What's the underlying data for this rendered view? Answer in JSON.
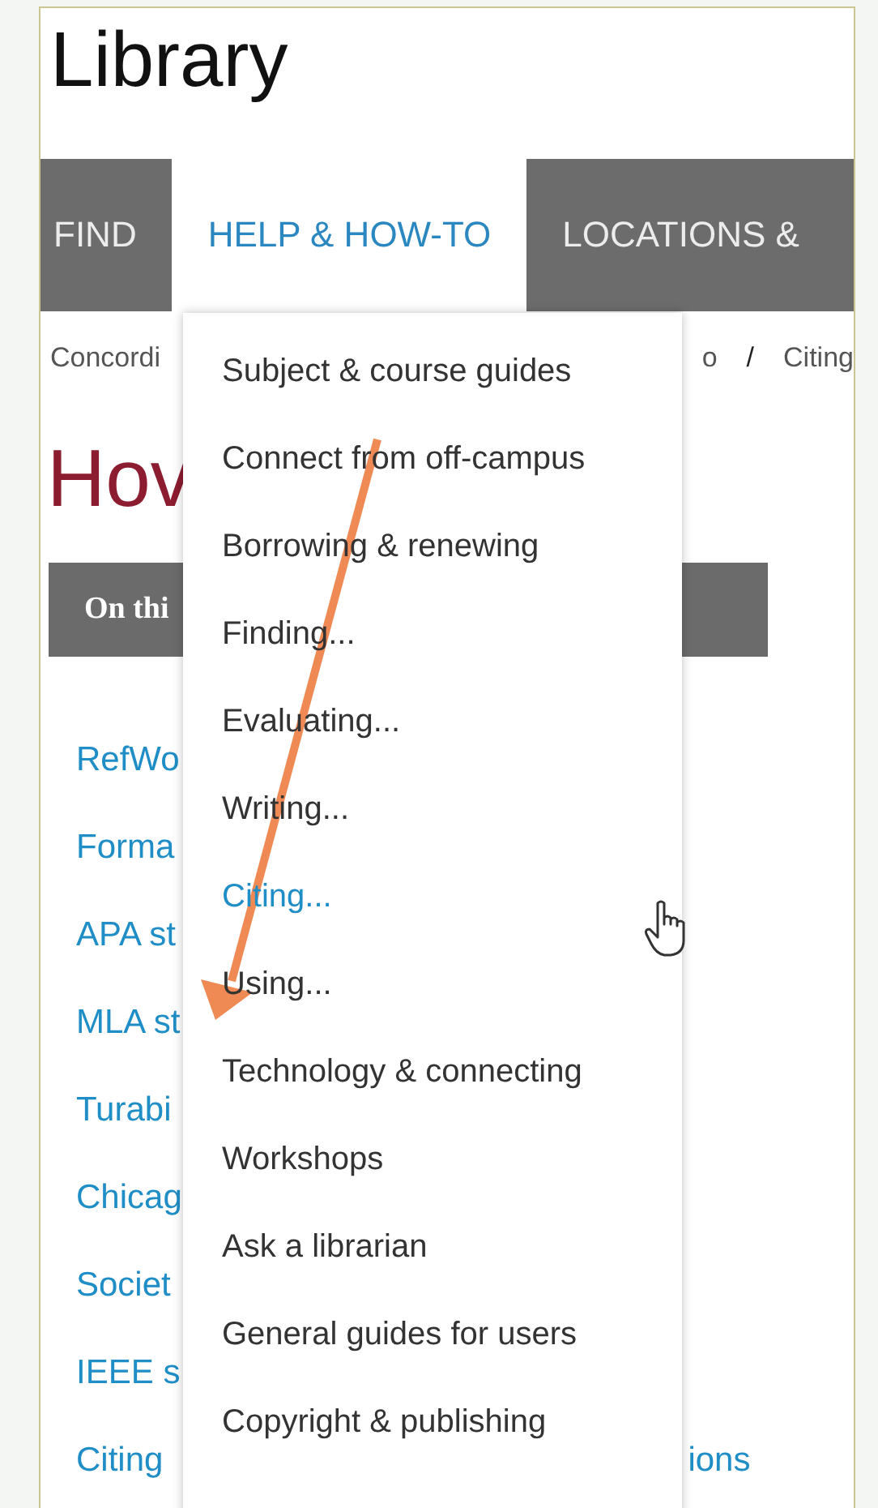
{
  "header": {
    "title": "Library"
  },
  "nav": {
    "tabs": [
      {
        "label": "FIND",
        "selected": false
      },
      {
        "label": "HELP & HOW-TO",
        "selected": true
      },
      {
        "label": "LOCATIONS &",
        "selected": false
      }
    ]
  },
  "breadcrumb": {
    "left": "Concordi",
    "right": [
      "o",
      "/",
      "Citing"
    ]
  },
  "heading": "Hov",
  "on_this_page": "On thi",
  "links": [
    {
      "text": "RefWo"
    },
    {
      "text": "Forma"
    },
    {
      "text": "APA st"
    },
    {
      "text": "MLA st"
    },
    {
      "text": "Turabi"
    },
    {
      "text": "Chicag"
    },
    {
      "text": "Societ"
    },
    {
      "text": "IEEE s"
    },
    {
      "text": "Citing",
      "tail": "ions"
    }
  ],
  "dropdown": {
    "items": [
      {
        "label": "Subject & course guides",
        "selected": false
      },
      {
        "label": "Connect from off-campus",
        "selected": false
      },
      {
        "label": "Borrowing & renewing",
        "selected": false
      },
      {
        "label": "Finding...",
        "selected": false
      },
      {
        "label": "Evaluating...",
        "selected": false
      },
      {
        "label": "Writing...",
        "selected": false
      },
      {
        "label": "Citing...",
        "selected": true
      },
      {
        "label": "Using...",
        "selected": false
      },
      {
        "label": "Technology & connecting",
        "selected": false
      },
      {
        "label": "Workshops",
        "selected": false
      },
      {
        "label": "Ask a librarian",
        "selected": false
      },
      {
        "label": "General guides for users",
        "selected": false
      },
      {
        "label": "Copyright & publishing",
        "selected": false
      }
    ]
  }
}
